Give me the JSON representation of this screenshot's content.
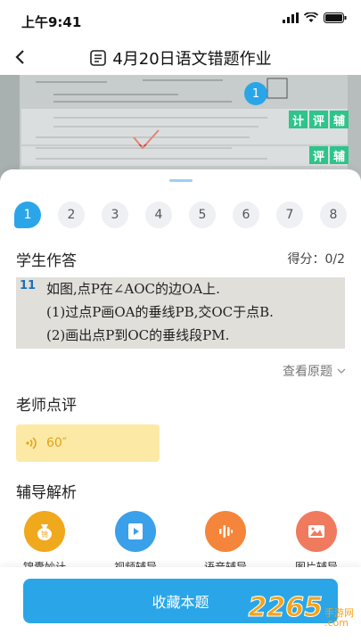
{
  "status": {
    "time": "上午9:41"
  },
  "nav": {
    "title": "4月20日语文错题作业"
  },
  "photo": {
    "pin": "1",
    "row1_tags": [
      "计",
      "评",
      "辅"
    ],
    "row2_tags": [
      "评",
      "辅"
    ]
  },
  "questions": {
    "numbers": [
      "1",
      "2",
      "3",
      "4",
      "5",
      "6",
      "7",
      "8"
    ]
  },
  "answer": {
    "heading": "学生作答",
    "score": "得分：0/2",
    "question_no": "11",
    "lines": [
      "如图,点P在∠AOC的边OA上.",
      "(1)过点P画OA的垂线PB,交OC于点B.",
      "(2)画出点P到OC的垂线段PM."
    ],
    "view_original": "查看原题"
  },
  "review": {
    "heading": "老师点评",
    "duration": "60″"
  },
  "tutor": {
    "heading": "辅导解析",
    "tools": [
      {
        "label": "锦囊妙计",
        "color": "#f0a81c",
        "icon": "bag-icon"
      },
      {
        "label": "视频辅导",
        "color": "#3aa0ea",
        "icon": "video-icon"
      },
      {
        "label": "语音辅导",
        "color": "#f5853a",
        "icon": "voice-icon"
      },
      {
        "label": "图片辅导",
        "color": "#f07a5e",
        "icon": "image-icon"
      }
    ]
  },
  "bottom": {
    "save_label": "收藏本题"
  },
  "watermark": {
    "number": "2265",
    "suffix": "手游网",
    "domain": ".com"
  },
  "colors": {
    "accent": "#2aa6e8",
    "tag_green": "#2ec48a",
    "voice_bg": "#fde9a6"
  }
}
